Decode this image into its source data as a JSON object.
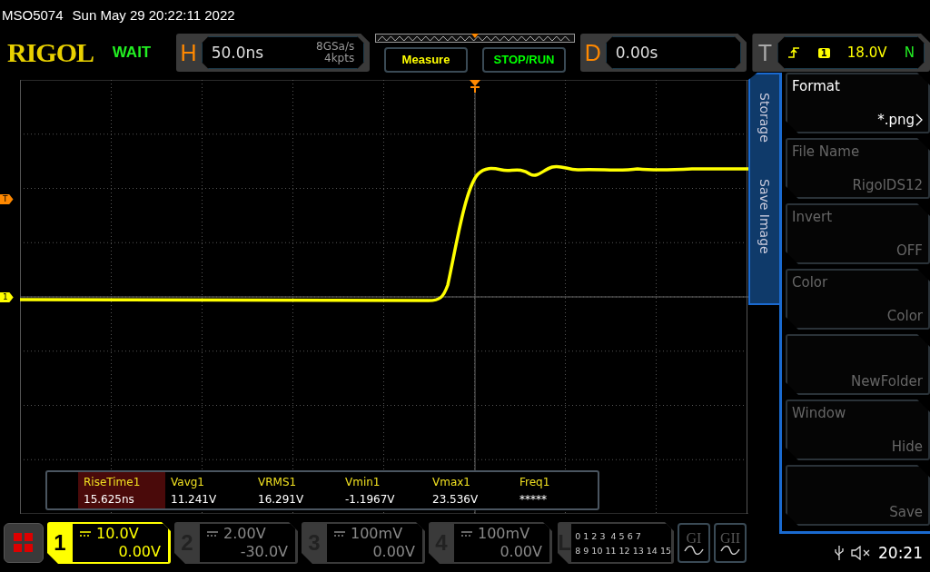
{
  "status_line": {
    "model": "MSO5074",
    "datetime": "Sun May 29 20:22:11 2022"
  },
  "header": {
    "logo": "RIGOL",
    "run_state": "WAIT",
    "horizontal": {
      "label": "H",
      "timebase": "50.0ns",
      "sample_rate": "8GSa/s",
      "memory_depth": "4kpts"
    },
    "buttons": [
      {
        "label": "Measure",
        "color": "#ffff00"
      },
      {
        "label": "STOP/RUN",
        "color": "#00ff00"
      }
    ],
    "delay": {
      "label": "D",
      "value": "0.00s"
    },
    "trigger": {
      "label": "T",
      "channel": "1",
      "level": "18.0V",
      "mode": "N"
    }
  },
  "plot": {
    "trigger_marker": "T",
    "channel_marker": "1"
  },
  "measurements": [
    {
      "label": "RiseTime1",
      "value": "15.625ns",
      "selected": true
    },
    {
      "label": "Vavg1",
      "value": "11.241V",
      "selected": false
    },
    {
      "label": "VRMS1",
      "value": "16.291V",
      "selected": false
    },
    {
      "label": "Vmin1",
      "value": "-1.1967V",
      "selected": false
    },
    {
      "label": "Vmax1",
      "value": "23.536V",
      "selected": false
    },
    {
      "label": "Freq1",
      "value": "*****",
      "selected": false
    }
  ],
  "side_menu": {
    "tabs": [
      "Storage",
      "Save Image"
    ],
    "items": [
      {
        "label": "Format",
        "value": "*.png",
        "has_submenu": true,
        "disabled": false
      },
      {
        "label": "File Name",
        "value": "RigolDS12",
        "has_submenu": false,
        "disabled": true
      },
      {
        "label": "Invert",
        "value": "OFF",
        "has_submenu": false,
        "disabled": true
      },
      {
        "label": "Color",
        "value": "Color",
        "has_submenu": false,
        "disabled": true
      },
      {
        "value": "NewFolder",
        "has_submenu": false,
        "disabled": true
      },
      {
        "label": "Window",
        "value": "Hide",
        "has_submenu": false,
        "disabled": true
      },
      {
        "value": "Save",
        "has_submenu": false,
        "disabled": true
      }
    ]
  },
  "channels": [
    {
      "number": "1",
      "scale": "10.0V",
      "offset": "0.00V",
      "selected": true
    },
    {
      "number": "2",
      "scale": "2.00V",
      "offset": "-30.0V",
      "selected": false
    },
    {
      "number": "3",
      "scale": "100mV",
      "offset": "0.00V",
      "selected": false
    },
    {
      "number": "4",
      "scale": "100mV",
      "offset": "0.00V",
      "selected": false
    }
  ],
  "logic": {
    "label": "L",
    "bits_row1": "0 1 2 3  4 5 6 7",
    "bits_row2": "8 9 10 11 12 13 14 15"
  },
  "generators": [
    {
      "label": "GI"
    },
    {
      "label": "GII"
    }
  ],
  "status": {
    "time": "20:21",
    "muted": true
  }
}
